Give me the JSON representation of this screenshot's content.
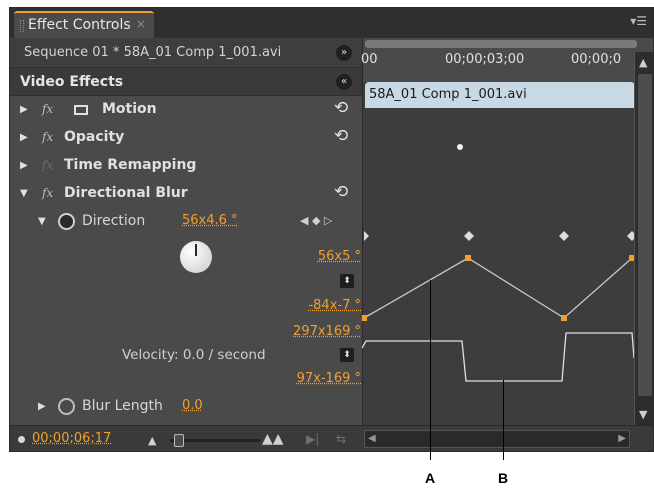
{
  "panel": {
    "tab_title": "Effect Controls",
    "tab_close": "×",
    "menu_icon": "panel-menu-icon"
  },
  "sequence_row": {
    "label": "Sequence 01 * 58A_01 Comp 1_001.avi",
    "show_clip_button": "»"
  },
  "video_effects": {
    "label": "Video Effects",
    "collapse_button": "«"
  },
  "effects": [
    {
      "name": "Motion",
      "fx_enabled": true,
      "has_reset": true
    },
    {
      "name": "Opacity",
      "fx_enabled": true,
      "has_reset": true
    },
    {
      "name": "Time Remapping",
      "fx_enabled": false,
      "has_reset": false
    },
    {
      "name": "Directional Blur",
      "fx_enabled": true,
      "has_reset": true
    }
  ],
  "direction": {
    "name": "Direction",
    "value": "56x4.6 °",
    "value_max": "56x5 °",
    "value_min": "-84x-7 °",
    "velocity_max": "297x169 °",
    "velocity_min": "97x-169 °",
    "velocity_text": "Velocity: 0.0 / second"
  },
  "blur_length": {
    "name": "Blur Length",
    "value": "0.0"
  },
  "bottom": {
    "timecode": "00;00;06;17"
  },
  "timeline": {
    "ticks": [
      "00",
      "00;00;03;00",
      "00;00;0"
    ],
    "clip_name": "58A_01 Comp 1_001.avi"
  },
  "callouts": {
    "a": "A",
    "b": "B"
  },
  "colors": {
    "accent": "#f0a030",
    "panel_bg": "#4a4a4a",
    "clip_bar": "#c6d9e4"
  }
}
